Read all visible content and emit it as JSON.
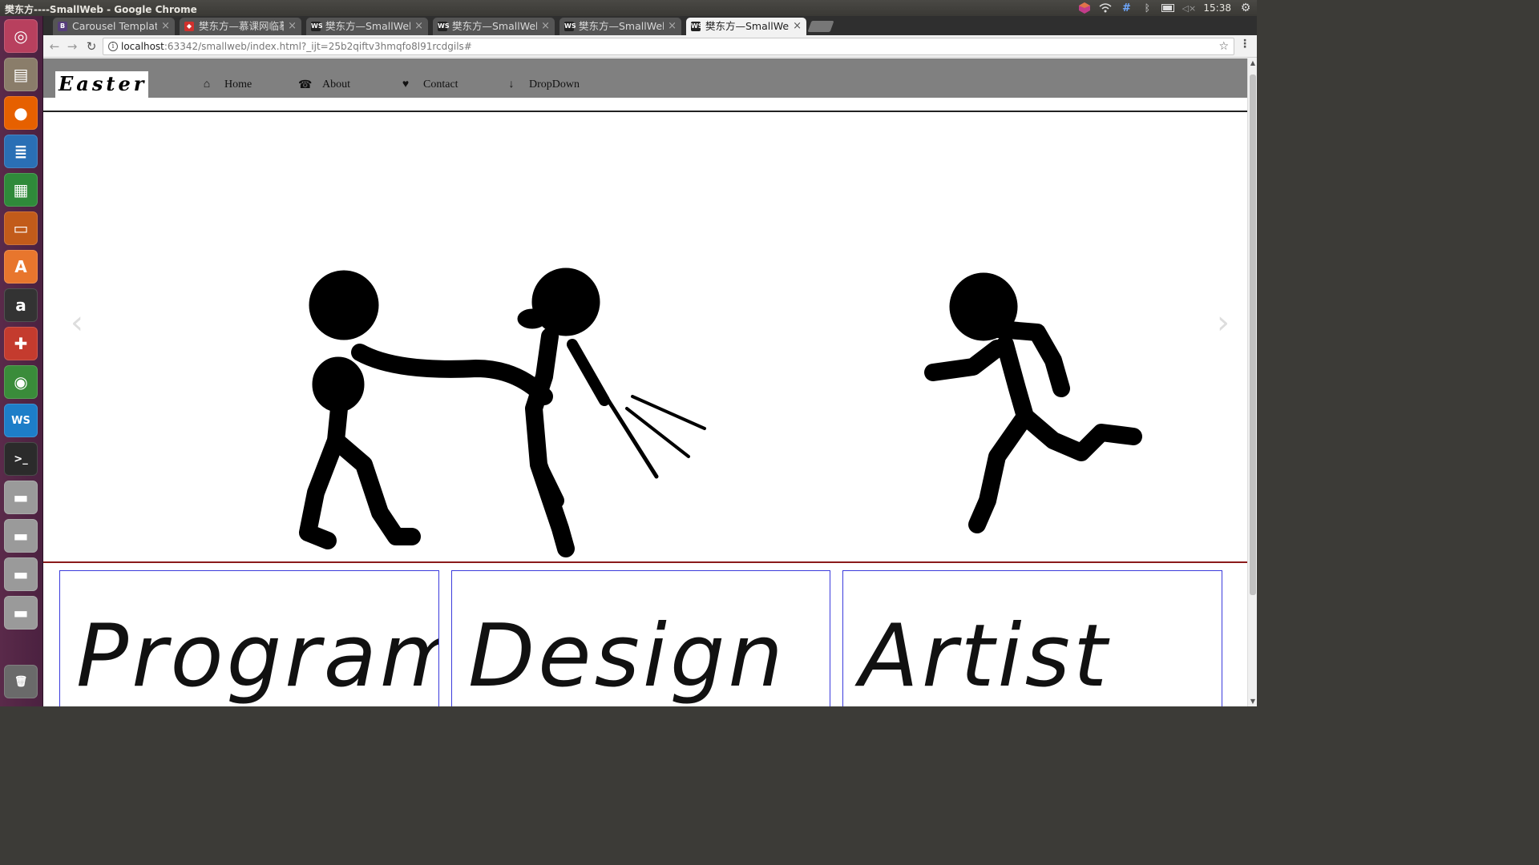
{
  "os": {
    "window_title": "樊东方----SmallWeb - Google Chrome",
    "clock": "15:38",
    "launcher_apps": [
      {
        "name": "dash-icon",
        "glyph": "◎",
        "color": "#b8405e"
      },
      {
        "name": "files-icon",
        "glyph": "▤",
        "color": "#8a7d6a"
      },
      {
        "name": "firefox-icon",
        "glyph": "●",
        "color": "#e66000"
      },
      {
        "name": "writer-icon",
        "glyph": "≣",
        "color": "#2a6fb5"
      },
      {
        "name": "calc-icon",
        "glyph": "▦",
        "color": "#2f8a3a"
      },
      {
        "name": "impress-icon",
        "glyph": "▭",
        "color": "#c25b1a"
      },
      {
        "name": "software-center-icon",
        "glyph": "A",
        "color": "#e8762d"
      },
      {
        "name": "amazon-icon",
        "glyph": "a",
        "color": "#333333"
      },
      {
        "name": "system-settings-icon",
        "glyph": "✚",
        "color": "#c43b2e"
      },
      {
        "name": "chrome-icon",
        "glyph": "◉",
        "color": "#3a8c3a"
      },
      {
        "name": "webstorm-icon",
        "glyph": "WS",
        "color": "#1d7ec8"
      },
      {
        "name": "terminal-icon",
        "glyph": ">_",
        "color": "#2b2b2b"
      },
      {
        "name": "drive-icon-1",
        "glyph": "▬",
        "color": "#9a9a9a"
      },
      {
        "name": "drive-icon-2",
        "glyph": "▬",
        "color": "#9a9a9a"
      },
      {
        "name": "drive-icon-3",
        "glyph": "▬",
        "color": "#9a9a9a"
      },
      {
        "name": "drive-icon-4",
        "glyph": "▬",
        "color": "#9a9a9a"
      },
      {
        "name": "trash-icon",
        "glyph": "🗑",
        "color": "#6a6a6a"
      }
    ]
  },
  "browser": {
    "tabs": [
      {
        "label": "Carousel Template",
        "favicon": "B",
        "favicon_color": "#563d7c",
        "active": false
      },
      {
        "label": "樊东方—慕课网临摹",
        "favicon": "◆",
        "favicon_color": "#d0312d",
        "active": false
      },
      {
        "label": "樊东方—SmallWeb",
        "favicon": "WS",
        "favicon_color": "#222222",
        "active": false
      },
      {
        "label": "樊东方—SmallWeb",
        "favicon": "WS",
        "favicon_color": "#222222",
        "active": false
      },
      {
        "label": "樊东方—SmallWeb",
        "favicon": "WS",
        "favicon_color": "#222222",
        "active": false
      },
      {
        "label": "樊东方—SmallWeb",
        "favicon": "WS",
        "favicon_color": "#222222",
        "active": true
      }
    ],
    "url_host": "localhost",
    "url_rest": ":63342/smallweb/index.html?_ijt=25b2qiftv3hmqfo8l91rcdgils#"
  },
  "site": {
    "brand": "Easter",
    "nav": [
      {
        "label": "Home",
        "icon": "home-icon",
        "glyph": "⌂"
      },
      {
        "label": "About",
        "icon": "phone-icon",
        "glyph": "☎"
      },
      {
        "label": "Contact",
        "icon": "heart-icon",
        "glyph": "♥"
      },
      {
        "label": "DropDown",
        "icon": "arrow-down-icon",
        "glyph": "↓"
      }
    ],
    "carousel": {
      "prev_glyph": "‹",
      "next_glyph": "›"
    },
    "cards": [
      {
        "title": "Program"
      },
      {
        "title": "Design"
      },
      {
        "title": "Artist"
      }
    ]
  }
}
